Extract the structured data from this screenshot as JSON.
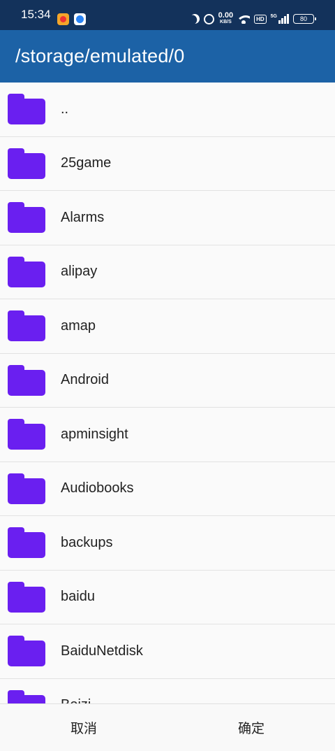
{
  "status_bar": {
    "time": "15:34",
    "net_speed_value": "0.00",
    "net_speed_unit": "KB/S",
    "hd_label": "HD",
    "network_label": "5G",
    "battery": "80",
    "icons": [
      "weibo-app-icon",
      "blue-app-icon",
      "moon-icon",
      "alarm-icon",
      "wifi-icon",
      "hd-icon",
      "signal-icon",
      "battery-icon"
    ]
  },
  "header": {
    "path": "/storage/emulated/0"
  },
  "list": {
    "items": [
      {
        "label": ".."
      },
      {
        "label": "25game"
      },
      {
        "label": "Alarms"
      },
      {
        "label": "alipay"
      },
      {
        "label": "amap"
      },
      {
        "label": "Android"
      },
      {
        "label": "apminsight"
      },
      {
        "label": "Audiobooks"
      },
      {
        "label": "backups"
      },
      {
        "label": "baidu"
      },
      {
        "label": "BaiduNetdisk"
      },
      {
        "label": "Beizi"
      }
    ]
  },
  "footer": {
    "cancel_label": "取消",
    "ok_label": "确定"
  },
  "colors": {
    "status_bar": "#13325b",
    "app_bar": "#1c62a6",
    "folder": "#6a1ff0"
  }
}
